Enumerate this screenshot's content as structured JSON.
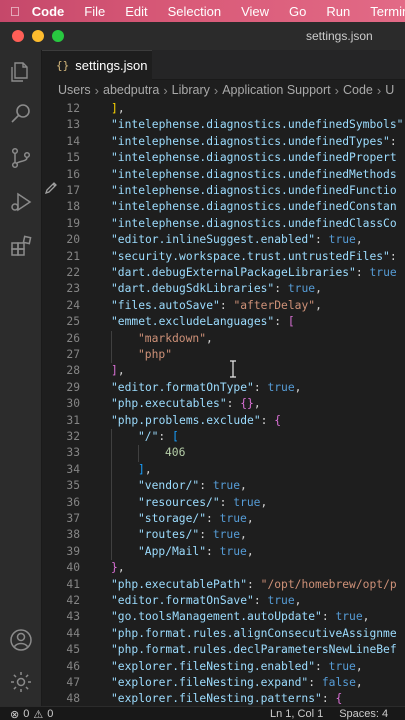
{
  "menubar": {
    "app": "Code",
    "items": [
      "File",
      "Edit",
      "Selection",
      "View",
      "Go",
      "Run",
      "Termin"
    ]
  },
  "window": {
    "title": "settings.json"
  },
  "tab": {
    "label": "settings.json",
    "icon": "{}"
  },
  "breadcrumb": [
    "Users",
    "abedputra",
    "Library",
    "Application Support",
    "Code",
    "U"
  ],
  "editor": {
    "lines": [
      {
        "n": "12",
        "indent": 1,
        "tokens": [
          [
            "]",
            "br3"
          ],
          [
            ",",
            "p"
          ]
        ]
      },
      {
        "n": "13",
        "indent": 1,
        "tokens": [
          [
            "\"intelephense.diagnostics.undefinedSymbols\"",
            "k"
          ]
        ]
      },
      {
        "n": "14",
        "indent": 1,
        "tokens": [
          [
            "\"intelephense.diagnostics.undefinedTypes\"",
            "k"
          ],
          [
            ":",
            "p"
          ]
        ]
      },
      {
        "n": "15",
        "indent": 1,
        "tokens": [
          [
            "\"intelephense.diagnostics.undefinedPropert",
            "k"
          ]
        ]
      },
      {
        "n": "16",
        "indent": 1,
        "tokens": [
          [
            "\"intelephense.diagnostics.undefinedMethods",
            "k"
          ]
        ]
      },
      {
        "n": "17",
        "indent": 1,
        "tokens": [
          [
            "\"intelephense.diagnostics.undefinedFunctio",
            "k"
          ]
        ]
      },
      {
        "n": "18",
        "indent": 1,
        "tokens": [
          [
            "\"intelephense.diagnostics.undefinedConstan",
            "k"
          ]
        ]
      },
      {
        "n": "19",
        "indent": 1,
        "tokens": [
          [
            "\"intelephense.diagnostics.undefinedClassCo",
            "k"
          ]
        ]
      },
      {
        "n": "20",
        "indent": 1,
        "tokens": [
          [
            "\"editor.inlineSuggest.enabled\"",
            "k"
          ],
          [
            ": ",
            "p"
          ],
          [
            "true",
            "b"
          ],
          [
            ",",
            "p"
          ]
        ]
      },
      {
        "n": "21",
        "indent": 1,
        "tokens": [
          [
            "\"security.workspace.trust.untrustedFiles\"",
            "k"
          ],
          [
            ":",
            "p"
          ]
        ]
      },
      {
        "n": "22",
        "indent": 1,
        "tokens": [
          [
            "\"dart.debugExternalPackageLibraries\"",
            "k"
          ],
          [
            ": ",
            "p"
          ],
          [
            "true",
            "b"
          ]
        ]
      },
      {
        "n": "23",
        "indent": 1,
        "tokens": [
          [
            "\"dart.debugSdkLibraries\"",
            "k"
          ],
          [
            ": ",
            "p"
          ],
          [
            "true",
            "b"
          ],
          [
            ",",
            "p"
          ]
        ]
      },
      {
        "n": "24",
        "indent": 1,
        "tokens": [
          [
            "\"files.autoSave\"",
            "k"
          ],
          [
            ": ",
            "p"
          ],
          [
            "\"afterDelay\"",
            "s"
          ],
          [
            ",",
            "p"
          ]
        ]
      },
      {
        "n": "25",
        "indent": 1,
        "tokens": [
          [
            "\"emmet.excludeLanguages\"",
            "k"
          ],
          [
            ": ",
            "p"
          ],
          [
            "[",
            "br1"
          ]
        ]
      },
      {
        "n": "26",
        "indent": 2,
        "tokens": [
          [
            "\"markdown\"",
            "s"
          ],
          [
            ",",
            "p"
          ]
        ]
      },
      {
        "n": "27",
        "indent": 2,
        "tokens": [
          [
            "\"php\"",
            "s"
          ]
        ]
      },
      {
        "n": "28",
        "indent": 1,
        "tokens": [
          [
            "]",
            "br1"
          ],
          [
            ",",
            "p"
          ]
        ]
      },
      {
        "n": "29",
        "indent": 1,
        "tokens": [
          [
            "\"editor.formatOnType\"",
            "k"
          ],
          [
            ": ",
            "p"
          ],
          [
            "true",
            "b"
          ],
          [
            ",",
            "p"
          ]
        ]
      },
      {
        "n": "30",
        "indent": 1,
        "tokens": [
          [
            "\"php.executables\"",
            "k"
          ],
          [
            ": ",
            "p"
          ],
          [
            "{}",
            "br1"
          ],
          [
            ",",
            "p"
          ]
        ]
      },
      {
        "n": "31",
        "indent": 1,
        "tokens": [
          [
            "\"php.problems.exclude\"",
            "k"
          ],
          [
            ": ",
            "p"
          ],
          [
            "{",
            "br1"
          ]
        ]
      },
      {
        "n": "32",
        "indent": 2,
        "tokens": [
          [
            "\"/\"",
            "k"
          ],
          [
            ": ",
            "p"
          ],
          [
            "[",
            "br2"
          ]
        ]
      },
      {
        "n": "33",
        "indent": 3,
        "tokens": [
          [
            "406",
            "n"
          ]
        ]
      },
      {
        "n": "34",
        "indent": 2,
        "tokens": [
          [
            "]",
            "br2"
          ],
          [
            ",",
            "p"
          ]
        ]
      },
      {
        "n": "35",
        "indent": 2,
        "tokens": [
          [
            "\"vendor/\"",
            "k"
          ],
          [
            ": ",
            "p"
          ],
          [
            "true",
            "b"
          ],
          [
            ",",
            "p"
          ]
        ]
      },
      {
        "n": "36",
        "indent": 2,
        "tokens": [
          [
            "\"resources/\"",
            "k"
          ],
          [
            ": ",
            "p"
          ],
          [
            "true",
            "b"
          ],
          [
            ",",
            "p"
          ]
        ]
      },
      {
        "n": "37",
        "indent": 2,
        "tokens": [
          [
            "\"storage/\"",
            "k"
          ],
          [
            ": ",
            "p"
          ],
          [
            "true",
            "b"
          ],
          [
            ",",
            "p"
          ]
        ]
      },
      {
        "n": "38",
        "indent": 2,
        "tokens": [
          [
            "\"routes/\"",
            "k"
          ],
          [
            ": ",
            "p"
          ],
          [
            "true",
            "b"
          ],
          [
            ",",
            "p"
          ]
        ]
      },
      {
        "n": "39",
        "indent": 2,
        "tokens": [
          [
            "\"App/Mail\"",
            "k"
          ],
          [
            ": ",
            "p"
          ],
          [
            "true",
            "b"
          ],
          [
            ",",
            "p"
          ]
        ]
      },
      {
        "n": "40",
        "indent": 1,
        "tokens": [
          [
            "}",
            "br1"
          ],
          [
            ",",
            "p"
          ]
        ]
      },
      {
        "n": "41",
        "indent": 1,
        "tokens": [
          [
            "\"php.executablePath\"",
            "k"
          ],
          [
            ": ",
            "p"
          ],
          [
            "\"/opt/homebrew/opt/p",
            "s"
          ]
        ]
      },
      {
        "n": "42",
        "indent": 1,
        "tokens": [
          [
            "\"editor.formatOnSave\"",
            "k"
          ],
          [
            ": ",
            "p"
          ],
          [
            "true",
            "b"
          ],
          [
            ",",
            "p"
          ]
        ]
      },
      {
        "n": "43",
        "indent": 1,
        "tokens": [
          [
            "\"go.toolsManagement.autoUpdate\"",
            "k"
          ],
          [
            ": ",
            "p"
          ],
          [
            "true",
            "b"
          ],
          [
            ",",
            "p"
          ]
        ]
      },
      {
        "n": "44",
        "indent": 1,
        "tokens": [
          [
            "\"php.format.rules.alignConsecutiveAssignme",
            "k"
          ]
        ]
      },
      {
        "n": "45",
        "indent": 1,
        "tokens": [
          [
            "\"php.format.rules.declParametersNewLineBef",
            "k"
          ]
        ]
      },
      {
        "n": "46",
        "indent": 1,
        "tokens": [
          [
            "\"explorer.fileNesting.enabled\"",
            "k"
          ],
          [
            ": ",
            "p"
          ],
          [
            "true",
            "b"
          ],
          [
            ",",
            "p"
          ]
        ]
      },
      {
        "n": "47",
        "indent": 1,
        "tokens": [
          [
            "\"explorer.fileNesting.expand\"",
            "k"
          ],
          [
            ": ",
            "p"
          ],
          [
            "false",
            "b"
          ],
          [
            ",",
            "p"
          ]
        ]
      },
      {
        "n": "48",
        "indent": 1,
        "tokens": [
          [
            "\"explorer.fileNesting.patterns\"",
            "k"
          ],
          [
            ": ",
            "p"
          ],
          [
            "{",
            "br1"
          ]
        ]
      }
    ]
  },
  "statusbar": {
    "errors": "0",
    "warnings": "0",
    "position": "Ln 1, Col 1",
    "spaces": "Spaces: 4"
  },
  "icons": {
    "activity": [
      "files-icon",
      "search-icon",
      "source-control-icon",
      "run-debug-icon",
      "extensions-icon",
      "account-icon",
      "settings-gear-icon"
    ]
  },
  "colors": {
    "key": "#9cdcfe",
    "string": "#ce9178",
    "keyword": "#569cd6",
    "number": "#b5cea8"
  }
}
